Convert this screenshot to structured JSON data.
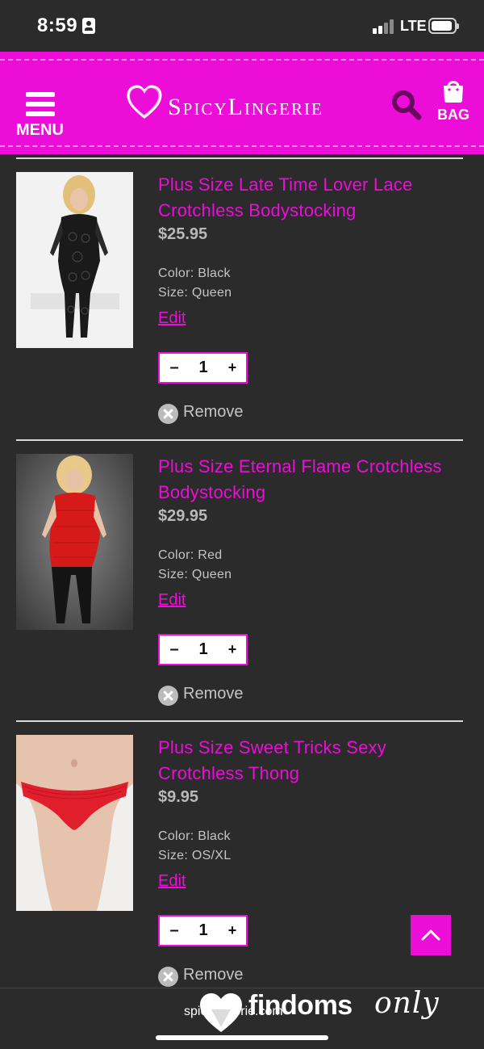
{
  "status_bar": {
    "time": "8:59",
    "network": "LTE"
  },
  "header": {
    "menu_label": "MENU",
    "logo_text": "SpicyLingerie",
    "bag_label": "BAG",
    "brand_color": "#ec0dd8"
  },
  "cart": {
    "items": [
      {
        "title": "Plus Size Late Time Lover Lace Crotchless Bodystocking",
        "price": "$25.95",
        "color_label": "Color:",
        "color_value": "Black",
        "size_label": "Size:",
        "size_value": "Queen",
        "edit_label": "Edit",
        "quantity": "1",
        "minus": "–",
        "plus": "+",
        "remove_label": "Remove",
        "image": "black-lace-bodystocking-photo"
      },
      {
        "title": "Plus Size Eternal Flame Crotchless Bodystocking",
        "price": "$29.95",
        "color_label": "Color:",
        "color_value": "Red",
        "size_label": "Size:",
        "size_value": "Queen",
        "edit_label": "Edit",
        "quantity": "1",
        "minus": "–",
        "plus": "+",
        "remove_label": "Remove",
        "image": "red-fishnet-bodystocking-photo"
      },
      {
        "title": "Plus Size Sweet Tricks Sexy Crotchless Thong",
        "price": "$9.95",
        "color_label": "Color:",
        "color_value": "Black",
        "size_label": "Size:",
        "size_value": "OS/XL",
        "edit_label": "Edit",
        "quantity": "1",
        "minus": "–",
        "plus": "+",
        "remove_label": "Remove",
        "image": "red-lace-thong-photo"
      }
    ]
  },
  "browser": {
    "url": "spicylingerie.com"
  },
  "watermark": {
    "part1": "findoms",
    "part2": "only"
  }
}
